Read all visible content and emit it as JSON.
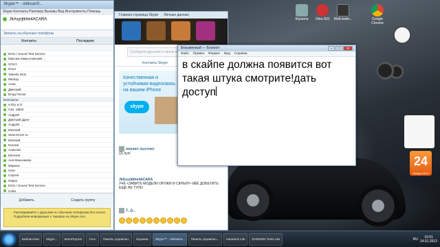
{
  "skype": {
    "title": "Skype™ - oleksan0...",
    "menu": "Skype  Контакты  Разговор  Вызовы  Вид  Инструменты  Помощь",
    "profile_name": "JkAsyrjtkhe4ACARA",
    "phone_link": "Звонить на обычные телефоны",
    "tabs": [
      "Контакты",
      "Последние"
    ],
    "contacts": [
      {
        "label": "Echo / Sound Test Service",
        "group": false
      },
      {
        "label": "Максим Замысловский ...",
        "group": false
      },
      {
        "label": "SOLO",
        "group": false
      },
      {
        "label": "Илья",
        "group": false
      },
      {
        "label": "Takeshi Dion",
        "group": false
      },
      {
        "label": "Nikolay",
        "group": false
      },
      {
        "label": "Анна",
        "group": false
      },
      {
        "label": "Дмитрий",
        "group": false
      },
      {
        "label": "Влад Попов",
        "group": false
      },
      {
        "label": "Контакты",
        "group": true
      },
      {
        "label": "4-Dry & D",
        "group": false
      },
      {
        "label": "Сas. rabbit",
        "group": false
      },
      {
        "label": "Андрей",
        "group": false
      },
      {
        "label": "Дмитрий Дрон",
        "group": false
      },
      {
        "label": "Андрей ...",
        "group": false
      },
      {
        "label": "Евгений",
        "group": false
      },
      {
        "label": "www.Iscore.ru",
        "group": false
      },
      {
        "label": "Евгений",
        "group": false
      },
      {
        "label": "Ксения",
        "group": false
      },
      {
        "label": "Алексей",
        "group": false
      },
      {
        "label": "Евгения",
        "group": false
      },
      {
        "label": "Аня Максимова",
        "group": false
      },
      {
        "label": "Марина",
        "group": false
      },
      {
        "label": "Олег",
        "group": false
      },
      {
        "label": "Сергей",
        "group": false
      },
      {
        "label": "Павел",
        "group": false
      },
      {
        "label": "Echo / Sound Test Service",
        "group": false
      },
      {
        "label": "Cuba",
        "group": false
      }
    ],
    "bottom": {
      "add": "Добавить",
      "create": "Создать группу"
    },
    "add_number": "Набрать номер",
    "ad_text": "Разговаривайте с друзьями по обычным телефонам без хлопот. Подробная информация о тарифах на Skype.com"
  },
  "home": {
    "tabs": [
      "Главная страница Skype",
      "Личные данные"
    ],
    "search_placeholder": "Сообщите друзьям о своем настроении",
    "subtabs": "Контакты Skype",
    "promo_title": "Качественная и устойчивая видеосвязь на вашем iPhone",
    "promo_logo": "skype",
    "feed": [
      {
        "name": "михаил лысенко",
        "text": "(2) пуп!"
      },
      {
        "name": "JkAsyrjtkhe4ACARA",
        "text": "УЧЁ <ЗАВИТЬ МОДЕЛИ ОРУЖИ И СКРЫЛ!> ИЁЁ ДОБЕТИТЬ ЕЩЁ НЕ ТУПО"
      },
      {
        "name": "T...D...",
        "text": ""
      }
    ]
  },
  "notepad": {
    "title": "Безымянный — Блокнот",
    "menu": [
      "Файл",
      "Правка",
      "Формат",
      "Вид",
      "Справка"
    ],
    "text": "в скайпе должна появится вот такая штука смотрите!дать доступ"
  },
  "calendar": {
    "day": "24",
    "month": "Январь 2012"
  },
  "desktop_icons": [
    {
      "label": "Корзина"
    },
    {
      "label": "Ultra ISO"
    },
    {
      "label": "Мой комп..."
    },
    {
      "label": "Google Chrome"
    }
  ],
  "taskbar": {
    "items": [
      "Библиотеки",
      "Skype...",
      "КиnoПортал",
      "Сеть",
      "Панель управлен.",
      "Корзина",
      "Skype™ - oleksan0...",
      "Панель управлен...",
      "Autoduck Lite",
      "DAEMON Tools Lite"
    ],
    "active_index": 6,
    "time": "15:01",
    "date": "24.01.2012",
    "lang": "RU"
  },
  "colors": {
    "skype_blue": "#00aff0",
    "calendar_orange": "#e25b12",
    "ad_yellow": "#f3e27a"
  }
}
